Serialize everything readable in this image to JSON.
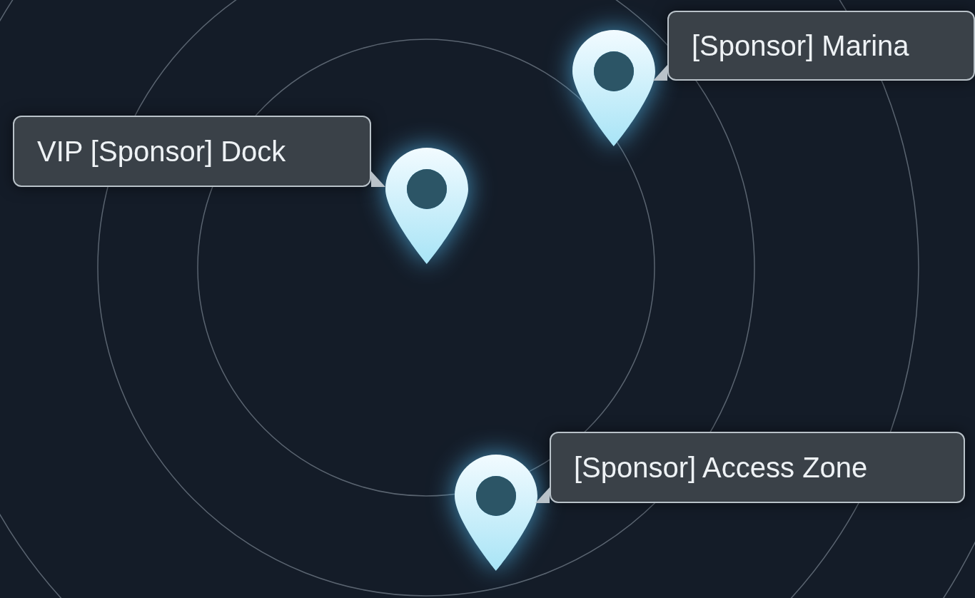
{
  "map": {
    "pins": [
      {
        "label": "[Sponsor] Marina"
      },
      {
        "label": "VIP [Sponsor] Dock"
      },
      {
        "label": "[Sponsor] Access Zone"
      }
    ]
  }
}
